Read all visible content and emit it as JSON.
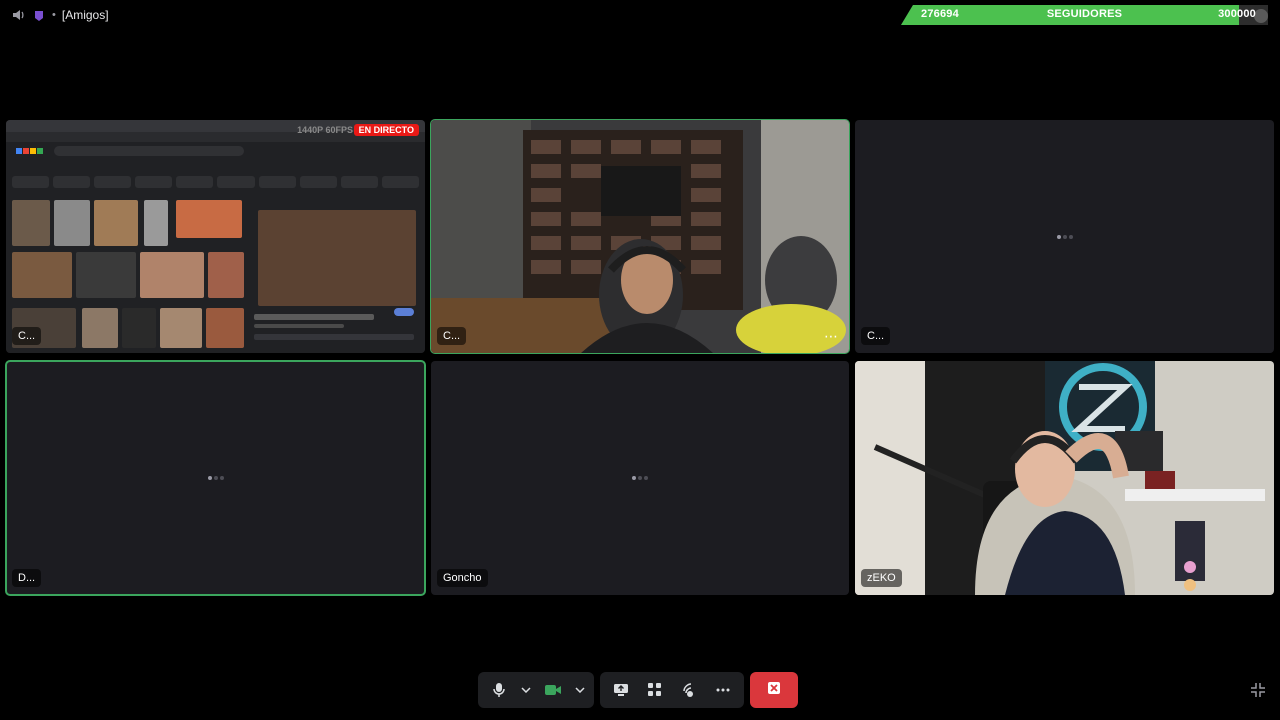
{
  "top_bar": {
    "channel_name": "[Amigos]",
    "speaker_icon": "speaker-icon",
    "app_icon": "app-icon",
    "separator": "•"
  },
  "followers_widget": {
    "current": "276694",
    "label": "SEGUIDORES",
    "goal": "300000",
    "progress": 0.922,
    "fill_color": "#4cc14f"
  },
  "tiles": [
    {
      "name": "C...",
      "state": "screen-share",
      "live_label": "EN DIRECTO",
      "resolution_label": "1440P 60FPS"
    },
    {
      "name": "C...",
      "state": "webcam",
      "speaking": true
    },
    {
      "name": "C...",
      "state": "loading"
    },
    {
      "name": "D...",
      "state": "loading",
      "speaking": true
    },
    {
      "name": "Goncho",
      "state": "loading"
    },
    {
      "name": "zEKO",
      "state": "webcam"
    }
  ],
  "controls": {
    "items": [
      {
        "icon": "microphone-icon"
      },
      {
        "icon": "chevron-down-icon"
      },
      {
        "icon": "camera-icon"
      },
      {
        "icon": "chevron-down-icon"
      },
      {
        "icon": "screen-share-icon"
      },
      {
        "icon": "activities-icon"
      },
      {
        "icon": "soundboard-icon"
      },
      {
        "icon": "more-icon"
      },
      {
        "icon": "disconnect-icon"
      },
      {
        "icon": "exit-fullscreen-icon"
      }
    ],
    "accent_green": "#3ba55d",
    "hangup_red": "#da373c"
  }
}
